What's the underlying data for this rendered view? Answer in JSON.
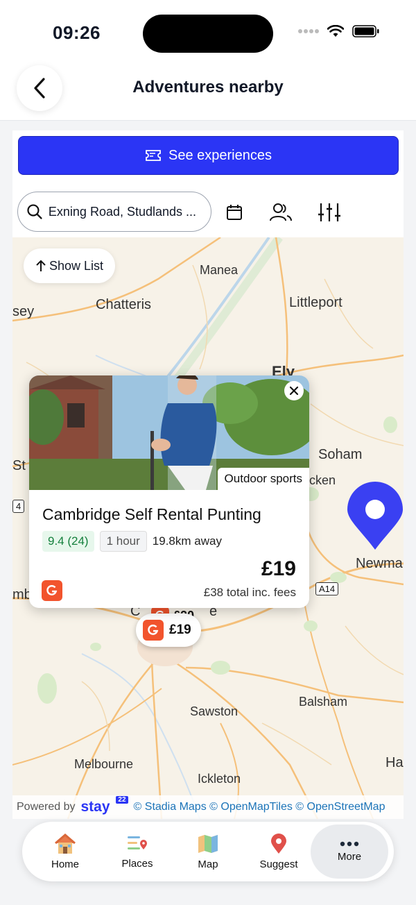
{
  "status_bar": {
    "time": "09:26"
  },
  "header": {
    "title": "Adventures nearby"
  },
  "cta": {
    "label": "See experiences"
  },
  "search": {
    "value": "Exning Road, Studlands ..."
  },
  "map": {
    "show_list_label": "Show List",
    "places": [
      "Manea",
      "Chatteris",
      "Littleport",
      "sey",
      "Ely",
      "Soham",
      "St I",
      "cken",
      "Newma",
      "mb",
      "Sawston",
      "Balsham",
      "Melbourne",
      "Ickleton",
      "Ha",
      "C",
      "e",
      "4"
    ],
    "road_badge": "A14",
    "pin_price": "£19",
    "pin_price_behind": "£20"
  },
  "card": {
    "category": "Outdoor sports",
    "title": "Cambridge Self Rental Punting",
    "rating": "9.4 (24)",
    "duration": "1 hour",
    "distance": "19.8km away",
    "price": "£19",
    "total": "£38 total inc. fees"
  },
  "attribution": {
    "powered_by": "Powered by",
    "brand": "stay",
    "brand_badge": "22",
    "links": "© Stadia Maps © OpenMapTiles © OpenStreetMap"
  },
  "nav": {
    "items": [
      {
        "label": "Home",
        "icon": "house-icon"
      },
      {
        "label": "Places",
        "icon": "places-icon"
      },
      {
        "label": "Map",
        "icon": "map-icon"
      },
      {
        "label": "Suggest",
        "icon": "pin-icon"
      },
      {
        "label": "More",
        "icon": "more-dots-icon"
      }
    ]
  },
  "colors": {
    "accent": "#2b35f5",
    "provider": "#f2542d",
    "map_bg": "#f7f2e8"
  }
}
